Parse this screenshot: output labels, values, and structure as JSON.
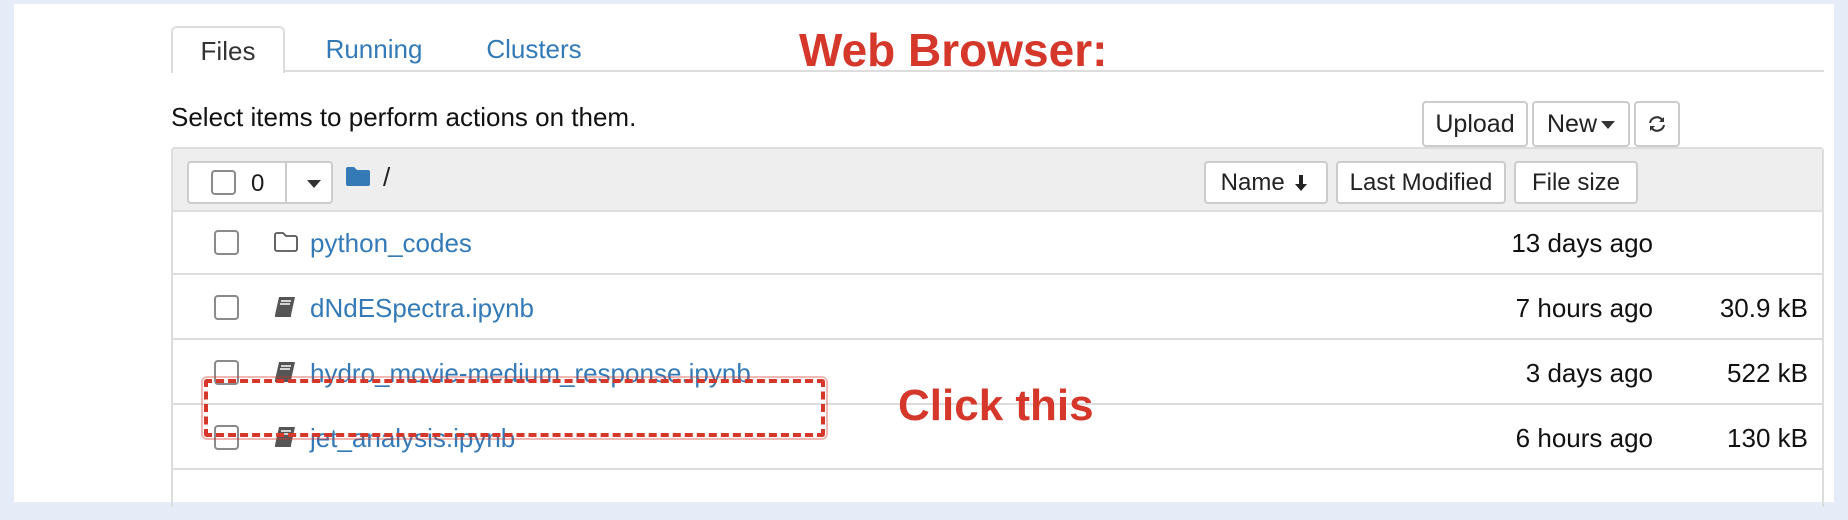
{
  "tabs": [
    {
      "label": "Files",
      "active": true
    },
    {
      "label": "Running",
      "active": false
    },
    {
      "label": "Clusters",
      "active": false
    }
  ],
  "annotation": {
    "title": "Web Browser:",
    "click_note": "Click this",
    "color": "#d5372a"
  },
  "toolbar": {
    "hint": "Select items to perform actions on them.",
    "upload_label": "Upload",
    "new_label": "New",
    "refresh_icon": "refresh-icon"
  },
  "list_header": {
    "selected_count": "0",
    "path": "/",
    "sort_name_label": "Name",
    "sort_modified_label": "Last Modified",
    "sort_size_label": "File size"
  },
  "files": [
    {
      "name": "python_codes",
      "type": "folder",
      "modified": "13 days ago",
      "size": ""
    },
    {
      "name": "dNdESpectra.ipynb",
      "type": "notebook",
      "modified": "7 hours ago",
      "size": "30.9 kB"
    },
    {
      "name": "hydro_movie-medium_response.ipynb",
      "type": "notebook",
      "modified": "3 days ago",
      "size": "522 kB"
    },
    {
      "name": "jet_analysis.ipynb",
      "type": "notebook",
      "modified": "6 hours ago",
      "size": "130 kB"
    }
  ],
  "colors": {
    "link": "#337ab7",
    "annotation": "#d5372a",
    "background": "#e5ecf8"
  }
}
